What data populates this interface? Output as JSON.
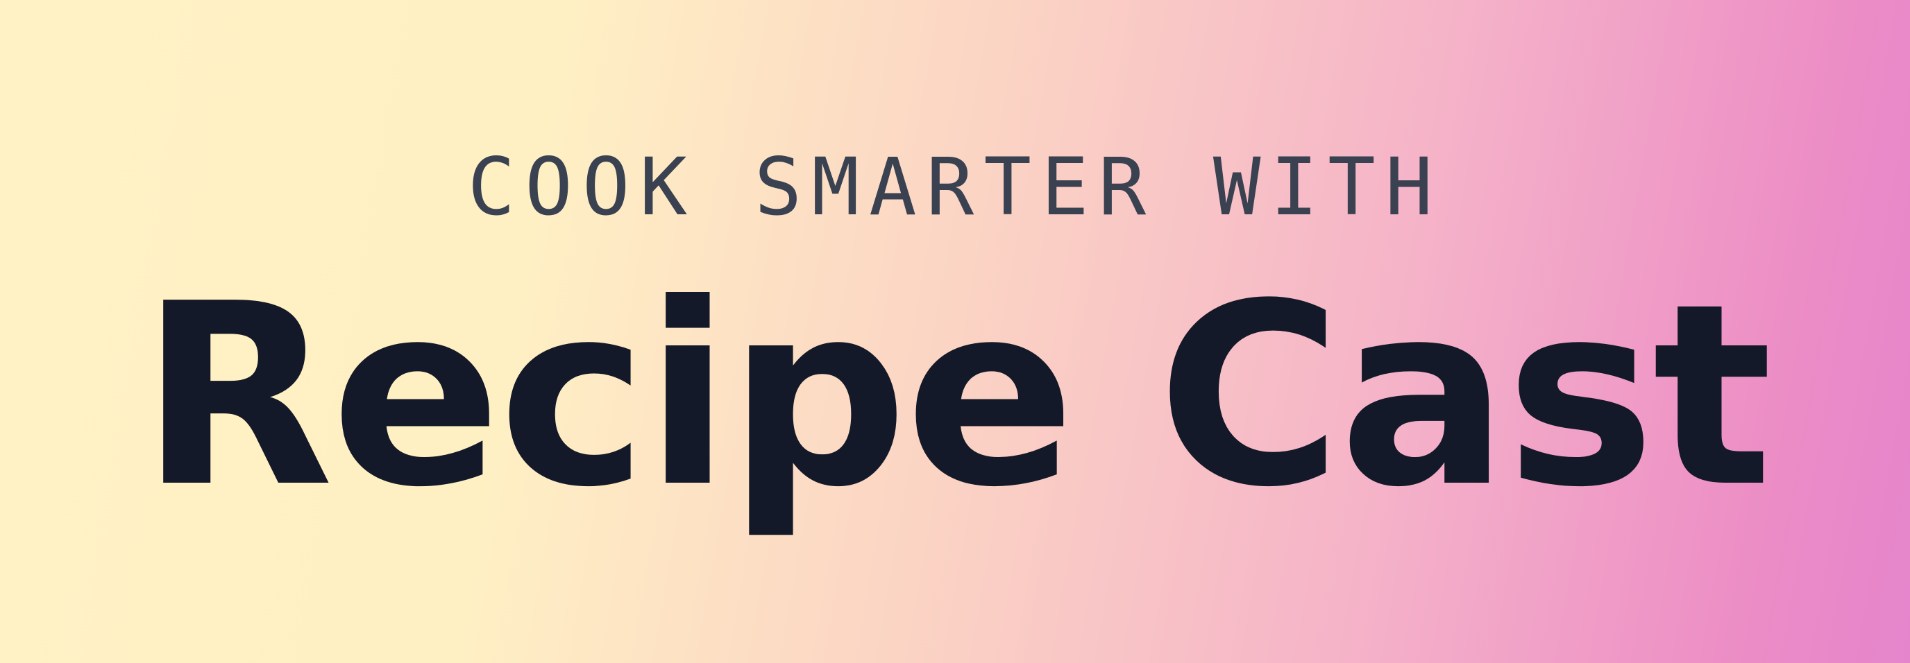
{
  "banner": {
    "eyebrow": "COOK SMARTER WITH",
    "title": "Recipe Cast"
  },
  "colors": {
    "gradient_start": "#fff2c5",
    "gradient_middle": "#fbd4c4",
    "gradient_end": "#e585cc",
    "eyebrow_text": "#3a4150",
    "title_text": "#131928"
  }
}
